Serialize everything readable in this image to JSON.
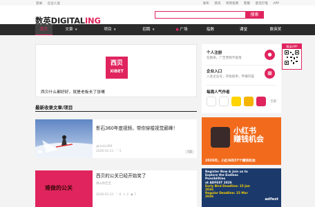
{
  "topbar": {
    "left": [
      "登录",
      "企业入驻"
    ],
    "right": [
      "发布",
      "快讯",
      "项目指南",
      "客服",
      "意见打电",
      "APP"
    ]
  },
  "header": {
    "logo_cn": "数英",
    "logo_main": "DIGITAL",
    "logo_accent": "ING",
    "search_placeholder": "",
    "search_button": "搜索"
  },
  "nav": {
    "items": [
      "首页",
      "文章",
      "项目",
      "招聘",
      "广场",
      "指数",
      "课堂",
      "数英奖"
    ]
  },
  "banner": {
    "logo_cn": "西贝",
    "logo_en": "XIBET",
    "text": "西贝什么都好好，就是老板长了张嘴"
  },
  "section": {
    "title": "最新收录文章/项目"
  },
  "articles": [
    {
      "title": "影石360年度视频，带你穿梭视觉巅峰！",
      "author": "@insta360",
      "date": "2026-01-21",
      "likes": "5",
      "tag": "1篇"
    },
    {
      "title": "西贝的公关已经开始笑了",
      "author": "佛山你佳至",
      "date": "2026-01-21",
      "likes": "6",
      "comments": "2",
      "views": "7",
      "thumb_text": "难做的公关"
    }
  ],
  "sidebar": {
    "rows": [
      {
        "title": "个人注册",
        "sub": "在数英，广告营销不能落",
        "icon": "person-icon"
      },
      {
        "title": "企业入口",
        "sub": "入驻企业号，开始接单，传播内容",
        "icon": "company-icon"
      }
    ],
    "authors_title": "每周人气作者",
    "all_label": "全部"
  },
  "qr": {
    "label": "数英APP"
  },
  "ad1": {
    "big1": "小红书",
    "big2": "赚钱机会",
    "foot": "2026年，小红书的37个赚钱机会"
  },
  "ad2": {
    "line1": "Register Now & Join us to",
    "line2": "Explore the Endless Possibilities",
    "line3": "at ADFEST 2026",
    "line4": "Early Bird Deadline: 15 Jan 2026",
    "line5": "Regular Deadline: 15 Mar 2026",
    "brand": "adfest"
  },
  "colors": {
    "accent": "#e0245e",
    "nav": "#2b2b2b",
    "ad_orange": "#f26b1d",
    "ad_blue": "#1b3a6b"
  }
}
